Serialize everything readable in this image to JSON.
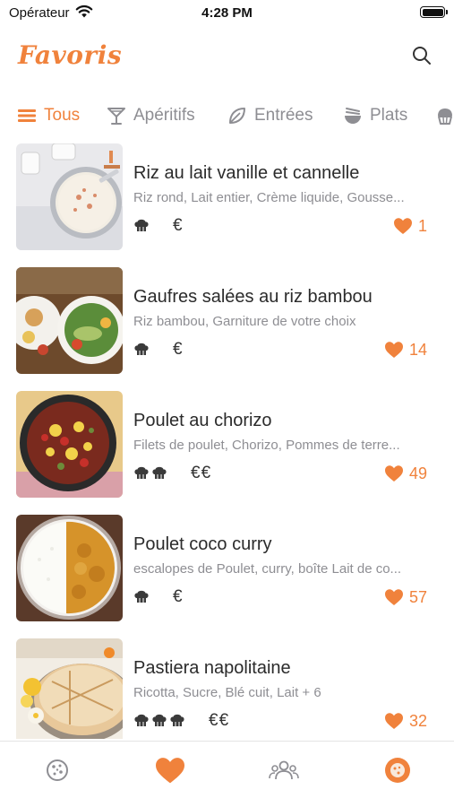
{
  "status_bar": {
    "carrier": "Opérateur",
    "time": "4:28 PM"
  },
  "header": {
    "title": "Favoris",
    "search_icon": "search-icon"
  },
  "accent_color": "#f0823c",
  "categories": [
    {
      "label": "Tous",
      "icon": "list-icon",
      "active": true
    },
    {
      "label": "Apéritifs",
      "icon": "cocktail-glass-icon",
      "active": false
    },
    {
      "label": "Entrées",
      "icon": "leaf-icon",
      "active": false
    },
    {
      "label": "Plats",
      "icon": "bowl-icon",
      "active": false
    },
    {
      "label": "",
      "icon": "cupcake-icon",
      "active": false
    }
  ],
  "recipes": [
    {
      "title": "Riz au lait vanille et cannelle",
      "ingredients": "Riz rond, Lait entier, Crème liquide, Gousse...",
      "difficulty": 1,
      "price": "€",
      "likes": "1",
      "image": "rice-pudding-photo"
    },
    {
      "title": "Gaufres salées au riz bambou",
      "ingredients": "Riz bambou, Garniture de votre choix",
      "difficulty": 1,
      "price": "€",
      "likes": "14",
      "image": "savory-waffles-photo"
    },
    {
      "title": "Poulet au chorizo",
      "ingredients": "Filets de poulet, Chorizo, Pommes de terre...",
      "difficulty": 2,
      "price": "€€",
      "likes": "49",
      "image": "chicken-chorizo-photo"
    },
    {
      "title": "Poulet coco curry",
      "ingredients": "escalopes de Poulet, curry, boîte Lait de co...",
      "difficulty": 1,
      "price": "€",
      "likes": "57",
      "image": "coconut-curry-photo"
    },
    {
      "title": "Pastiera napolitaine",
      "ingredients": "Ricotta, Sucre, Blé cuit, Lait + 6",
      "difficulty": 3,
      "price": "€€",
      "likes": "32",
      "image": "pastiera-photo"
    }
  ],
  "tabbar": [
    {
      "icon": "cookie-icon",
      "active": false
    },
    {
      "icon": "heart-icon",
      "active": true
    },
    {
      "icon": "community-icon",
      "active": false
    },
    {
      "icon": "profile-icon",
      "active": false
    }
  ]
}
